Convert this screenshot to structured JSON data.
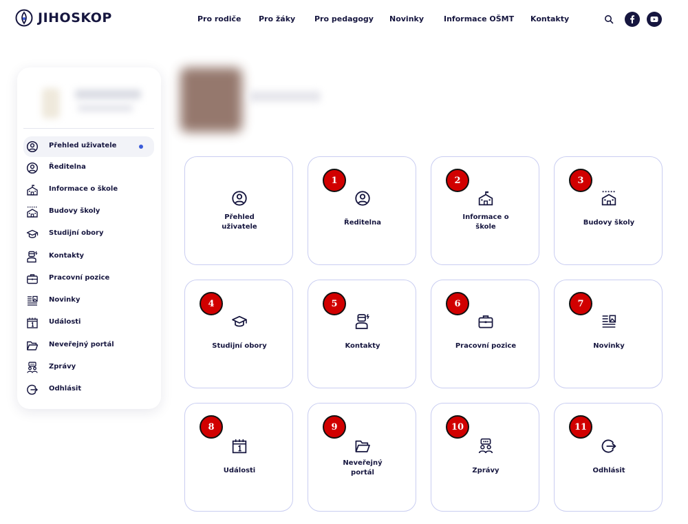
{
  "header": {
    "logo_text": "JIHOSKOP",
    "nav": [
      "Pro rodiče",
      "Pro žáky",
      "Pro pedagogy",
      "Novinky",
      "Informace OŠMT",
      "Kontakty"
    ],
    "icons": [
      "search-icon",
      "facebook-icon",
      "youtube-icon"
    ]
  },
  "sidebar": {
    "items": [
      {
        "label": "Přehled uživatele",
        "icon": "user-circle-icon",
        "active": true
      },
      {
        "label": "Ředitelna",
        "icon": "user-circle-icon"
      },
      {
        "label": "Informace o škole",
        "icon": "school-icon"
      },
      {
        "label": "Budovy školy",
        "icon": "buildings-icon"
      },
      {
        "label": "Studijní obory",
        "icon": "graduation-cap-icon"
      },
      {
        "label": "Kontakty",
        "icon": "contact-person-icon"
      },
      {
        "label": "Pracovní pozice",
        "icon": "briefcase-icon"
      },
      {
        "label": "Novinky",
        "icon": "news-icon"
      },
      {
        "label": "Události",
        "icon": "calendar-icon"
      },
      {
        "label": "Neveřejný portál",
        "icon": "folder-icon"
      },
      {
        "label": "Zprávy",
        "icon": "chat-group-icon"
      },
      {
        "label": "Odhlásit",
        "icon": "logout-icon"
      }
    ]
  },
  "cards": [
    {
      "label": "Přehled uživatele",
      "badge": ""
    },
    {
      "label": "Ředitelna",
      "badge": "1"
    },
    {
      "label": "Informace o škole",
      "badge": "2"
    },
    {
      "label": "Budovy školy",
      "badge": "3"
    },
    {
      "label": "Studijní obory",
      "badge": "4"
    },
    {
      "label": "Kontakty",
      "badge": "5"
    },
    {
      "label": "Pracovní pozice",
      "badge": "6"
    },
    {
      "label": "Novinky",
      "badge": "7"
    },
    {
      "label": "Události",
      "badge": "8"
    },
    {
      "label": "Neveřejný portál",
      "badge": "9"
    },
    {
      "label": "Zprávy",
      "badge": "10"
    },
    {
      "label": "Odhlásit",
      "badge": "11"
    }
  ],
  "colors": {
    "text": "#16163f",
    "accent_dot": "#3a5bd9",
    "card_border": "#c9cdf1",
    "badge": "#d10000"
  }
}
